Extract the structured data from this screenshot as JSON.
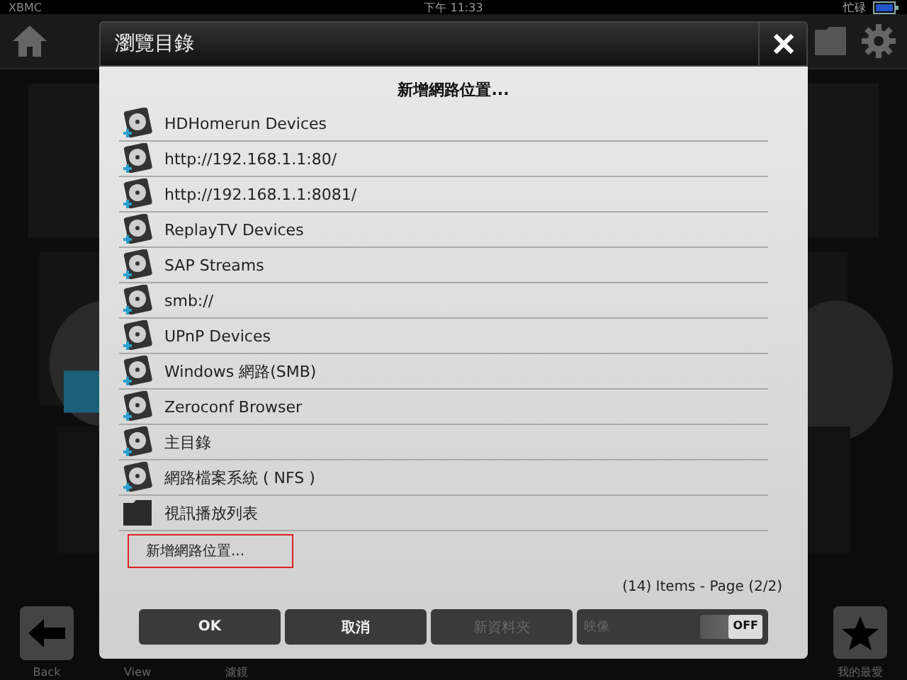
{
  "status_bar": {
    "app": "XBMC",
    "time": "下午 11:33",
    "status": "忙碌"
  },
  "bottom_bar": {
    "back": "Back",
    "view": "View",
    "filter": "濾鏡",
    "favourites": "我的最愛"
  },
  "dialog": {
    "title": "瀏覽目錄",
    "heading": "新增網路位置...",
    "items": [
      {
        "label": "HDHomerun Devices",
        "kind": "drive",
        "selected": false
      },
      {
        "label": "http://192.168.1.1:80/",
        "kind": "drive",
        "selected": false
      },
      {
        "label": "http://192.168.1.1:8081/",
        "kind": "drive",
        "selected": false
      },
      {
        "label": "ReplayTV Devices",
        "kind": "drive",
        "selected": false
      },
      {
        "label": "SAP Streams",
        "kind": "drive",
        "selected": false
      },
      {
        "label": "smb://",
        "kind": "drive",
        "selected": false
      },
      {
        "label": "UPnP Devices",
        "kind": "drive",
        "selected": false
      },
      {
        "label": "Windows 網路(SMB)",
        "kind": "drive",
        "selected": false
      },
      {
        "label": "Zeroconf Browser",
        "kind": "drive",
        "selected": false
      },
      {
        "label": "主目錄",
        "kind": "drive",
        "selected": false
      },
      {
        "label": "網路檔案系統 ( NFS )",
        "kind": "drive",
        "selected": false
      },
      {
        "label": "視訊播放列表",
        "kind": "folder",
        "selected": false
      },
      {
        "label": "新增網路位置...",
        "kind": "action",
        "selected": true
      }
    ],
    "page_info": "(14) Items - Page (2/2)",
    "buttons": [
      {
        "label": "OK",
        "disabled": false
      },
      {
        "label": "取消",
        "disabled": false
      },
      {
        "label": "新資料夾",
        "disabled": true
      }
    ],
    "toggle": {
      "label": "映像",
      "state": "OFF",
      "on": false,
      "disabled": true
    }
  }
}
